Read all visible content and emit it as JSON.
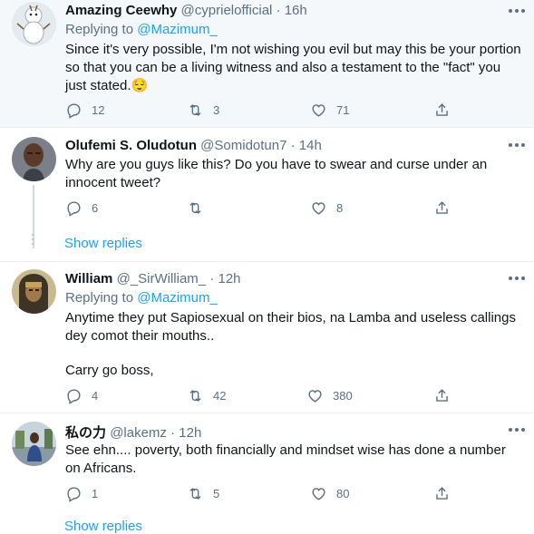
{
  "tweets": [
    {
      "name": "Amazing Ceewhy",
      "handle": "@cyprielofficial",
      "dot": "·",
      "time": "16h",
      "replying_label": "Replying to",
      "replying_mention": "@Mazimum_",
      "text": "Since it's very possible, I'm not wishing you evil but may this be your portion so that you can be a living witness and also a testament to the \"fact\" you just stated.",
      "emoji": "😌",
      "replies": "12",
      "retweets": "3",
      "likes": "71"
    },
    {
      "name": "Olufemi S. Oludotun",
      "handle": "@Somidotun7",
      "dot": "·",
      "time": "14h",
      "text": "Why are you guys like this? Do you have to swear and curse under an innocent tweet?",
      "replies": "6",
      "retweets": "",
      "likes": "8"
    },
    {
      "name": "William",
      "handle": "@_SirWilliam_",
      "dot": "·",
      "time": "12h",
      "replying_label": "Replying to",
      "replying_mention": "@Mazimum_",
      "text_line1": "Anytime they put Sapiosexual on their bios, na Lamba and useless callings dey comot their mouths..",
      "text_line2": "Carry go boss,",
      "replies": "4",
      "retweets": "42",
      "likes": "380"
    },
    {
      "name": "私の力",
      "handle": "@lakemz",
      "dot": "·",
      "time": "12h",
      "text": "See ehn.... poverty, both financially and mindset wise has done a number on Africans.",
      "replies": "1",
      "retweets": "5",
      "likes": "80"
    }
  ],
  "show_replies": "Show replies",
  "show_replies_partial": "Show replies",
  "colors": {
    "accent": "#1da1f2",
    "muted": "#5b7083",
    "highlight_bg": "#f5f8fa"
  }
}
